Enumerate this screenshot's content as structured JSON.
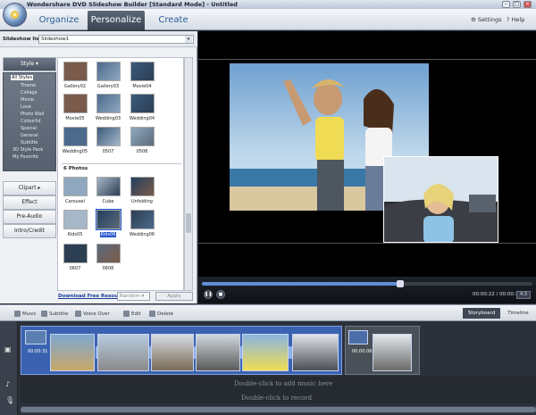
{
  "window": {
    "title": "Wondershare DVD Slideshow Builder [Standard Mode] - Untitled"
  },
  "menu": {
    "tabs": [
      "Organize",
      "Personalize",
      "Create"
    ],
    "active": "Personalize",
    "settings": "Settings",
    "help": "Help"
  },
  "slideshow_list": {
    "label": "Slideshow list :",
    "value": "Slideshow1"
  },
  "side": {
    "style_label": "Style",
    "styles": [
      "All Styles",
      "Theme",
      "Collage",
      "Movie",
      "Love",
      "Photo Wall",
      "Colourful",
      "Special",
      "General",
      "Subtitle",
      "3D Style Pack",
      "My Favorite"
    ],
    "selected_style": "All Styles",
    "buttons": [
      "Clipart",
      "Effect",
      "Pre-Audio",
      "Intro/Credit"
    ]
  },
  "grid": {
    "rows": [
      [
        "Gallery02",
        "Gallery03",
        "Movie04"
      ],
      [
        "Movie05",
        "Wedding03",
        "Wedding04"
      ],
      [
        "Wedding05",
        "0507",
        "0508"
      ]
    ],
    "section": "6 Photos",
    "rows2": [
      [
        "Carousel",
        "Cube",
        "Unfolding"
      ],
      [
        "Kids05",
        "Kids06",
        "Wedding06"
      ],
      [
        "0607",
        "0608"
      ]
    ],
    "selected": "Kids06"
  },
  "download_link": "Download Free Resource",
  "random_label": "Random",
  "apply_label": "Apply",
  "player": {
    "current": "00:00:22",
    "total": "00:00:37",
    "progress": 0.6,
    "ratio": "4:3"
  },
  "timeline_bar": {
    "music": "Music",
    "subtitle": "Subtitle",
    "voiceover": "Voice Over",
    "edit": "Edit",
    "delete": "Delete",
    "storyboard": "Storyboard",
    "timeline": "Timeline"
  },
  "storyboard": {
    "duration": "00:00:31",
    "duration2": "00:00:06",
    "music_hint": "Double-click to add music here",
    "record_hint": "Double-click to record"
  },
  "colors": {
    "accent": "#2a5c98",
    "selection": "#2255cc",
    "track": "#3a62b0"
  }
}
